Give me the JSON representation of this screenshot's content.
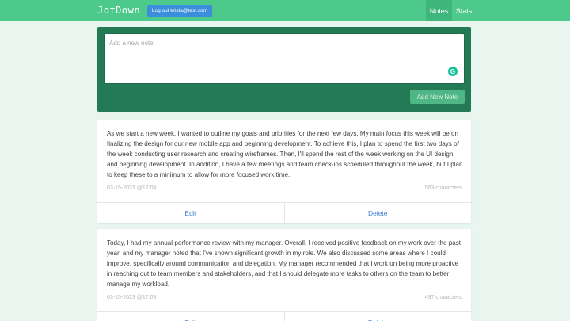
{
  "navbar": {
    "brand": "JotDown",
    "logout_label": "Log out krista@test.com",
    "links": [
      {
        "label": "Notes",
        "active": true
      },
      {
        "label": "Stats",
        "active": false
      }
    ]
  },
  "form": {
    "placeholder": "Add a new note",
    "value": "",
    "submit_label": "Add New Note",
    "assistant_icon": "grammarly-icon"
  },
  "notes": [
    {
      "body": "As we start a new week, I wanted to outline my goals and priorities for the next few days. My main focus this week will be on finalizing the design for our new mobile app and beginning development. To achieve this, I plan to spend the first two days of the week conducting user research and creating wireframes. Then, I'll spend the rest of the week working on the UI design and beginning development. In addition, I have a few meetings and team check-ins scheduled throughout the week, but I plan to keep these to a minimum to allow for more focused work time.",
      "timestamp": "03-15-2023 @17:04",
      "char_count": "563 characters",
      "edit_label": "Edit",
      "delete_label": "Delete"
    },
    {
      "body": "Today, I had my annual performance review with my manager. Overall, I received positive feedback on my work over the past year, and my manager noted that I've shown significant growth in my role. We also discussed some areas where I could improve, specifically around communication and delegation. My manager recommended that I work on being more proactive in reaching out to team members and stakeholders, and that I should delegate more tasks to others on the team to better manage my workload.",
      "timestamp": "03-15-2023 @17:03",
      "char_count": "497 characters",
      "edit_label": "Edit",
      "delete_label": "Delete"
    }
  ],
  "colors": {
    "navbar": "#4ec98c",
    "page_bg": "#e8f6ef",
    "form_bg": "#237a55",
    "logout_btn": "#3a8edb",
    "link": "#3f7fd1"
  }
}
